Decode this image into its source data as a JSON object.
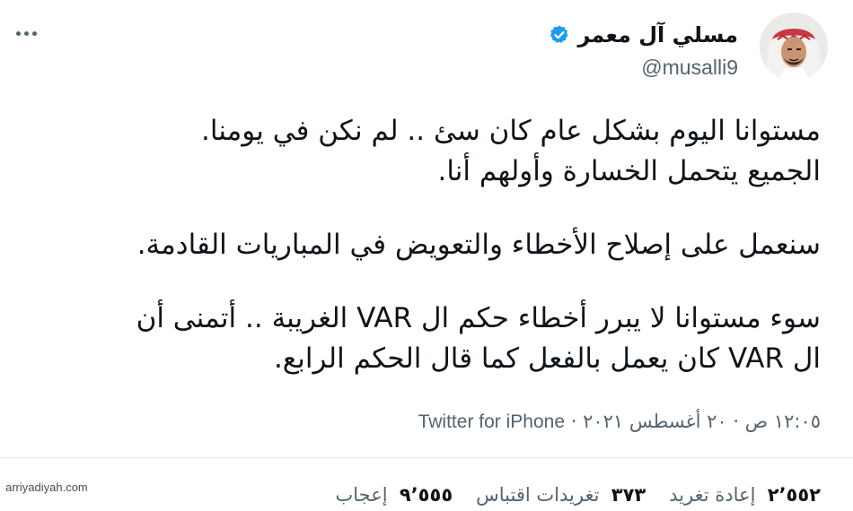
{
  "tweet": {
    "display_name": "مسلي آل معمر",
    "handle": "@musalli9",
    "verified_icon": "verified-badge-icon",
    "more_icon": "more-horizontal-icon",
    "body": [
      [
        "مستوانا اليوم بشكل عام كان سئ .. لم نكن في يومنا.",
        "الجميع يتحمل الخسارة وأولهم أنا."
      ],
      [
        "سنعمل على إصلاح الأخطاء والتعويض في المباريات القادمة."
      ],
      [
        "سوء مستوانا لا يبرر أخطاء حكم ال VAR الغريبة .. أتمنى أن",
        "ال VAR كان يعمل بالفعل كما قال الحكم الرابع."
      ]
    ],
    "time": "١٢:٠٥ ص",
    "date": "٢٠ أغسطس ٢٠٢١",
    "separator": "·",
    "source": "Twitter for iPhone"
  },
  "stats": {
    "retweets_count": "٢٬٥٥٢",
    "retweets_label": "إعادة تغريد",
    "quotes_count": "٣٧٣",
    "quotes_label": "تغريدات اقتباس",
    "likes_count": "٩٬٥٥٥",
    "likes_label": "إعجاب"
  },
  "watermark": "arriyadiyah.com",
  "colors": {
    "verified_blue": "#1d9bf0",
    "text": "#0f1419",
    "secondary": "#536471"
  }
}
